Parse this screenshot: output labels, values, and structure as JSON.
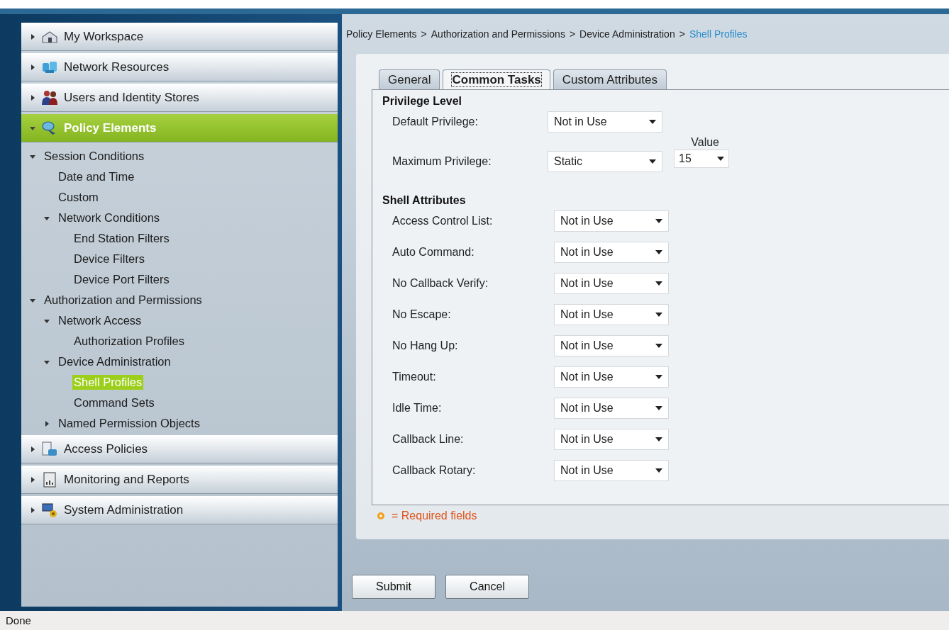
{
  "sidebar": {
    "sections": [
      {
        "label": "My Workspace",
        "expanded": false,
        "selected": false
      },
      {
        "label": "Network Resources",
        "expanded": false,
        "selected": false
      },
      {
        "label": "Users and Identity Stores",
        "expanded": false,
        "selected": false
      },
      {
        "label": "Policy Elements",
        "expanded": true,
        "selected": true,
        "children": [
          {
            "label": "Session Conditions",
            "expanded": true,
            "selected": false,
            "children": [
              {
                "label": "Date and Time",
                "selected": false
              },
              {
                "label": "Custom",
                "selected": false
              },
              {
                "label": "Network Conditions",
                "expanded": true,
                "selected": false,
                "children": [
                  {
                    "label": "End Station Filters",
                    "selected": false
                  },
                  {
                    "label": "Device Filters",
                    "selected": false
                  },
                  {
                    "label": "Device Port Filters",
                    "selected": false
                  }
                ]
              }
            ]
          },
          {
            "label": "Authorization and Permissions",
            "expanded": true,
            "selected": false,
            "children": [
              {
                "label": "Network Access",
                "expanded": true,
                "selected": false,
                "children": [
                  {
                    "label": "Authorization Profiles",
                    "selected": false
                  }
                ]
              },
              {
                "label": "Device Administration",
                "expanded": true,
                "selected": false,
                "children": [
                  {
                    "label": "Shell Profiles",
                    "selected": true
                  },
                  {
                    "label": "Command Sets",
                    "selected": false
                  }
                ]
              },
              {
                "label": "Named Permission Objects",
                "expanded": false,
                "selected": false
              }
            ]
          }
        ]
      },
      {
        "label": "Access Policies",
        "expanded": false,
        "selected": false
      },
      {
        "label": "Monitoring and Reports",
        "expanded": false,
        "selected": false
      },
      {
        "label": "System Administration",
        "expanded": false,
        "selected": false
      }
    ]
  },
  "breadcrumb": [
    {
      "label": "Policy Elements",
      "current": false
    },
    {
      "label": "Authorization and Permissions",
      "current": false
    },
    {
      "label": "Device Administration",
      "current": false
    },
    {
      "label": "Shell Profiles",
      "current": true
    }
  ],
  "breadcrumb_separator": ">",
  "tabs": [
    {
      "label": "General",
      "selected": false
    },
    {
      "label": "Common Tasks",
      "selected": true
    },
    {
      "label": "Custom Attributes",
      "selected": false
    }
  ],
  "privilege_level": {
    "title": "Privilege Level",
    "fields": [
      {
        "label": "Default Privilege:",
        "value": "Not in Use"
      },
      {
        "label": "Maximum Privilege:",
        "value": "Static",
        "value_field": {
          "label": "Value",
          "value": "15"
        }
      }
    ]
  },
  "shell_attributes": {
    "title": "Shell Attributes",
    "fields": [
      {
        "label": "Access Control List:",
        "value": "Not in Use"
      },
      {
        "label": "Auto Command:",
        "value": "Not in Use"
      },
      {
        "label": "No Callback Verify:",
        "value": "Not in Use"
      },
      {
        "label": "No Escape:",
        "value": "Not in Use"
      },
      {
        "label": "No Hang Up:",
        "value": "Not in Use"
      },
      {
        "label": "Timeout:",
        "value": "Not in Use"
      },
      {
        "label": "Idle Time:",
        "value": "Not in Use"
      },
      {
        "label": "Callback Line:",
        "value": "Not in Use"
      },
      {
        "label": "Callback Rotary:",
        "value": "Not in Use"
      }
    ]
  },
  "required_note": "= Required fields",
  "buttons": [
    "Submit",
    "Cancel"
  ],
  "status_bar": "Done"
}
